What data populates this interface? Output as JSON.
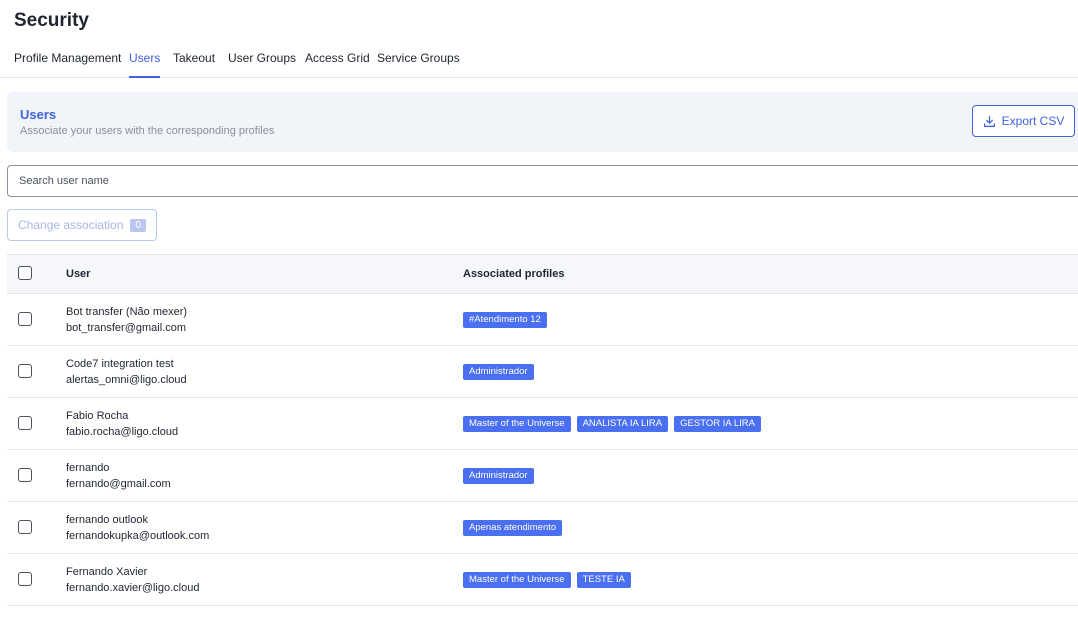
{
  "page": {
    "title": "Security"
  },
  "tabs": [
    {
      "label": "Profile Management"
    },
    {
      "label": "Users"
    },
    {
      "label": "Takeout"
    },
    {
      "label": "User Groups"
    },
    {
      "label": "Access Grid"
    },
    {
      "label": "Service Groups"
    }
  ],
  "active_tab": "Users",
  "header": {
    "title": "Users",
    "subtitle": "Associate your users with the corresponding profiles",
    "export_label": "Export CSV"
  },
  "search": {
    "placeholder": "Search user name",
    "value": ""
  },
  "change_association": {
    "label": "Change association",
    "count": "0"
  },
  "table": {
    "columns": {
      "user": "User",
      "profiles": "Associated profiles"
    },
    "rows": [
      {
        "name": "Bot transfer (Não mexer)",
        "email": "bot_transfer@gmail.com",
        "profiles": [
          "#Atendimento 12"
        ]
      },
      {
        "name": "Code7 integration test",
        "email": "alertas_omni@ligo.cloud",
        "profiles": [
          "Administrador"
        ]
      },
      {
        "name": "Fabio Rocha",
        "email": "fabio.rocha@ligo.cloud",
        "profiles": [
          "Master of the Universe",
          "ANALISTA IA LIRA",
          "GESTOR IA LIRA"
        ]
      },
      {
        "name": "fernando",
        "email": "fernando@gmail.com",
        "profiles": [
          "Administrador"
        ]
      },
      {
        "name": "fernando outlook",
        "email": "fernandokupka@outlook.com",
        "profiles": [
          "Apenas atendimento"
        ]
      },
      {
        "name": "Fernando Xavier",
        "email": "fernando.xavier@ligo.cloud",
        "profiles": [
          "Master of the Universe",
          "TESTE IA"
        ]
      }
    ]
  },
  "colors": {
    "accent": "#3f63d9",
    "badge": "#4a6ff0",
    "header_bg": "#f1f4f8"
  },
  "icons": {
    "export": "download-icon"
  }
}
